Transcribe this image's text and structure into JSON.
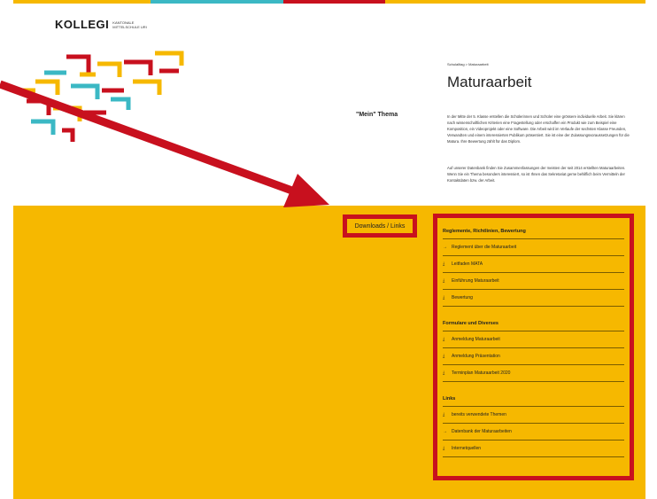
{
  "header": {
    "logo_word": "KOLLEGI",
    "logo_sub_line1": "KANTONALE",
    "logo_sub_line2": "MITTELSCHULE URI"
  },
  "colors": {
    "accent_yellow": "#f6b800",
    "accent_red": "#c8101e",
    "accent_teal": "#3bb8c4",
    "highlight_red": "#c8101e"
  },
  "breadcrumb": "Schulalltag > Maturaarbeit",
  "page_title": "Maturaarbeit",
  "section_label": "\"Mein\" Thema",
  "intro_paragraphs": [
    "In der Mitte der 5. Klasse erstellen die Schülerinnen und Schüler eine grössere individuelle Arbeit. Sie klären nach wissenschaftlichen Kriterien eine Fragestellung oder erschaffen ein Produkt wie zum Beispiel eine Komposition, ein Videoprojekt oder eine Software. Die Arbeit wird im Verlaufe der sechsten Klasse Freunden, Verwandten und einem interessierten Publikum präsentiert. Sie ist eine der Zulassungsvoraussetzungen für die Matura. Ihre Bewertung zählt für das Diplom.",
    "Auf unserer Datenbank finden Sie Zusammenfassungen der meisten der seit 2014 erstellten Maturaarbeiten. Wenn Sie ein Thema besonders interessiert, so ist Ihnen das Sekretariat gerne behilflich beim Vermitteln der Kontaktdaten bzw. der Arbeit."
  ],
  "downloads_label": "Downloads / Links",
  "groups": [
    {
      "title": "Reglemente, Richtlinien, Bewertung",
      "items": [
        {
          "icon": "arrow-right-icon",
          "glyph": "→",
          "label": "Reglement über die Maturaarbeit"
        },
        {
          "icon": "download-icon",
          "glyph": "⤓",
          "label": "Leitfaden MATA"
        },
        {
          "icon": "download-icon",
          "glyph": "⤓",
          "label": "Einführung Maturaarbeit"
        },
        {
          "icon": "download-icon",
          "glyph": "⤓",
          "label": "Bewertung"
        }
      ]
    },
    {
      "title": "Formulare und Diverses",
      "items": [
        {
          "icon": "download-icon",
          "glyph": "⤓",
          "label": "Anmeldung Maturaarbeit"
        },
        {
          "icon": "download-icon",
          "glyph": "⤓",
          "label": "Anmeldung Präsentation"
        },
        {
          "icon": "download-icon",
          "glyph": "⤓",
          "label": "Terminplan Maturaarbeit 2020"
        }
      ]
    },
    {
      "title": "Links",
      "items": [
        {
          "icon": "download-icon",
          "glyph": "⤓",
          "label": "bereits verwendete Themen"
        },
        {
          "icon": "arrow-right-icon",
          "glyph": "→",
          "label": "Datenbank der Maturaarbeiten"
        },
        {
          "icon": "download-icon",
          "glyph": "⤓",
          "label": "Internetquellen"
        }
      ]
    }
  ]
}
